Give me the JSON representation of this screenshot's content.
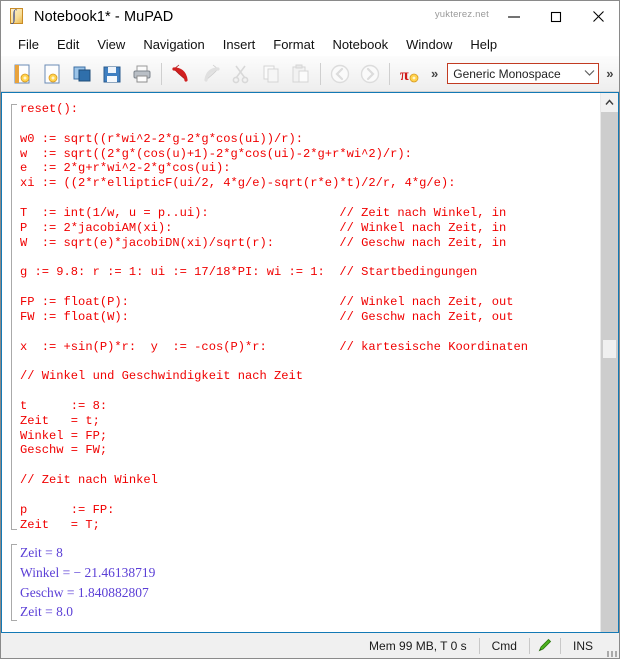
{
  "titlebar": {
    "title": "Notebook1* - MuPAD",
    "watermark": "yukterez.net",
    "app_icon": "mupad-document-icon",
    "minimize_label": "—",
    "maximize_label": "□",
    "close_label": "✕"
  },
  "menubar": {
    "items": [
      {
        "label": "File"
      },
      {
        "label": "Edit"
      },
      {
        "label": "View"
      },
      {
        "label": "Navigation"
      },
      {
        "label": "Insert"
      },
      {
        "label": "Format"
      },
      {
        "label": "Notebook"
      },
      {
        "label": "Window"
      },
      {
        "label": "Help"
      }
    ]
  },
  "toolbar": {
    "buttons": [
      {
        "name": "new-notebook-icon",
        "enabled": true
      },
      {
        "name": "new-document-icon",
        "enabled": true
      },
      {
        "name": "open-folder-icon",
        "enabled": true
      },
      {
        "name": "save-icon",
        "enabled": true
      },
      {
        "name": "print-icon",
        "enabled": true
      },
      {
        "name": "undo-icon",
        "enabled": true
      },
      {
        "name": "redo-icon",
        "enabled": false
      },
      {
        "name": "cut-scissors-icon",
        "enabled": false
      },
      {
        "name": "copy-icon",
        "enabled": false
      },
      {
        "name": "paste-icon",
        "enabled": false
      },
      {
        "name": "nav-back-icon",
        "enabled": false
      },
      {
        "name": "nav-forward-icon",
        "enabled": false
      },
      {
        "name": "evaluate-pi-icon",
        "enabled": true
      }
    ],
    "overflow_label": "»",
    "font_name": "Generic Monospace",
    "font_dropdown_caret": "∨",
    "overflow_label2": "»"
  },
  "editor": {
    "input_code": "reset():\n\nw0 := sqrt((r*wi^2-2*g-2*g*cos(ui))/r):\nw  := sqrt((2*g*(cos(u)+1)-2*g*cos(ui)-2*g+r*wi^2)/r):\ne  := 2*g+r*wi^2-2*g*cos(ui):\nxi := ((2*r*ellipticF(ui/2, 4*g/e)-sqrt(r*e)*t)/2/r, 4*g/e):\n\nT  := int(1/w, u = p..ui):                  // Zeit nach Winkel, in\nP  := 2*jacobiAM(xi):                       // Winkel nach Zeit, in\nW  := sqrt(e)*jacobiDN(xi)/sqrt(r):         // Geschw nach Zeit, in\n\ng := 9.8: r := 1: ui := 17/18*PI: wi := 1:  // Startbedingungen\n\nFP := float(P):                             // Winkel nach Zeit, out\nFW := float(W):                             // Geschw nach Zeit, out\n\nx  := +sin(P)*r:  y  := -cos(P)*r:          // kartesische Koordinaten\n\n// Winkel und Geschwindigkeit nach Zeit\n\nt      := 8:\nZeit   = t;\nWinkel = FP;\nGeschw = FW;\n\n// Zeit nach Winkel\n\np      := FP:\nZeit   = T;",
    "output_lines": [
      "Zeit = 8",
      "Winkel = − 21.46138719",
      "Geschw = 1.840882807",
      "Zeit = 8.0"
    ],
    "code_color": "#f00000",
    "output_color": "#5b3fd6",
    "frame_color": "#1379b5"
  },
  "statusbar": {
    "memory": "Mem 99 MB, T 0 s",
    "mode": "Cmd",
    "pencil_icon": "green-pencil-icon",
    "insert_mode": "INS",
    "resize_grip": "resize-grip-icon"
  }
}
